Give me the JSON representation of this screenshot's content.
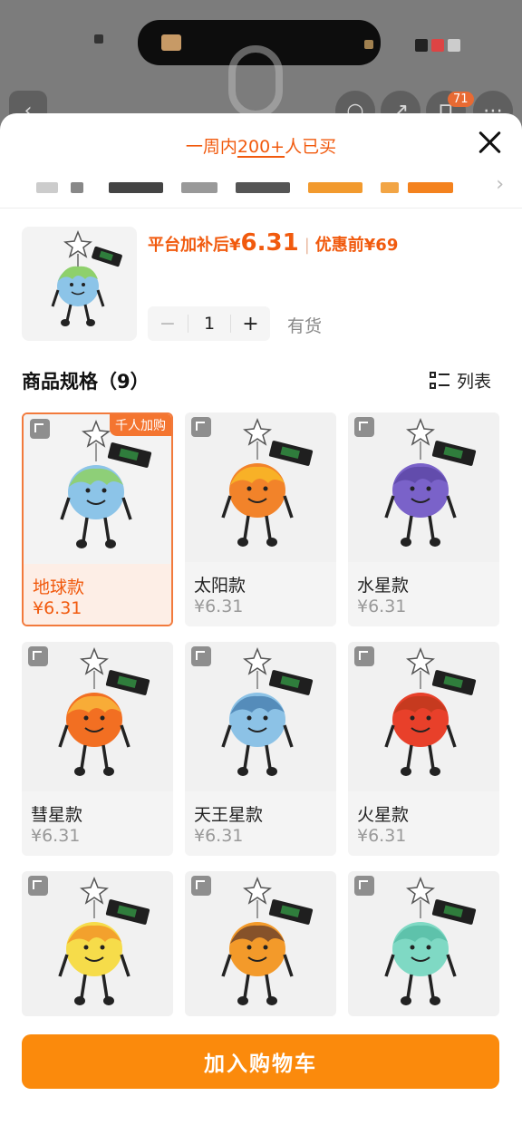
{
  "background_page": {
    "cart_count": "71"
  },
  "sheet": {
    "sales_note_prefix": "一周内",
    "sales_note_count": "200+",
    "sales_note_suffix": "人已买"
  },
  "product": {
    "price_label": "平台加补后",
    "price_currency": "¥",
    "price_value": "6.31",
    "original_label": "优惠前",
    "original_currency": "¥",
    "original_value": "69",
    "quantity": "1",
    "minus_label": "−",
    "plus_label": "+",
    "stock_status": "有货"
  },
  "specs": {
    "title": "商品规格（9）",
    "list_label": "列表",
    "badge": "千人加购",
    "items": [
      {
        "name": "地球款",
        "price": "¥6.31",
        "color": "#8cc4e8",
        "accent": "#8ed06b",
        "selected": true
      },
      {
        "name": "太阳款",
        "price": "¥6.31",
        "color": "#f2832a",
        "accent": "#f8b627",
        "selected": false
      },
      {
        "name": "水星款",
        "price": "¥6.31",
        "color": "#7a62c9",
        "accent": "#5f4aa8",
        "selected": false
      },
      {
        "name": "彗星款",
        "price": "¥6.31",
        "color": "#f26f22",
        "accent": "#f8b23a",
        "selected": false
      },
      {
        "name": "天王星款",
        "price": "¥6.31",
        "color": "#8cc2e6",
        "accent": "#4f86b5",
        "selected": false
      },
      {
        "name": "火星款",
        "price": "¥6.31",
        "color": "#e8402a",
        "accent": "#c23a1e",
        "selected": false
      },
      {
        "name": "",
        "price": "",
        "color": "#f6dc4a",
        "accent": "#f39a2a",
        "selected": false
      },
      {
        "name": "",
        "price": "",
        "color": "#f39a2a",
        "accent": "#7a4a2a",
        "selected": false
      },
      {
        "name": "",
        "price": "",
        "color": "#7fd9c4",
        "accent": "#5bbfa8",
        "selected": false
      }
    ]
  },
  "footer": {
    "add_to_cart": "加入购物车"
  }
}
